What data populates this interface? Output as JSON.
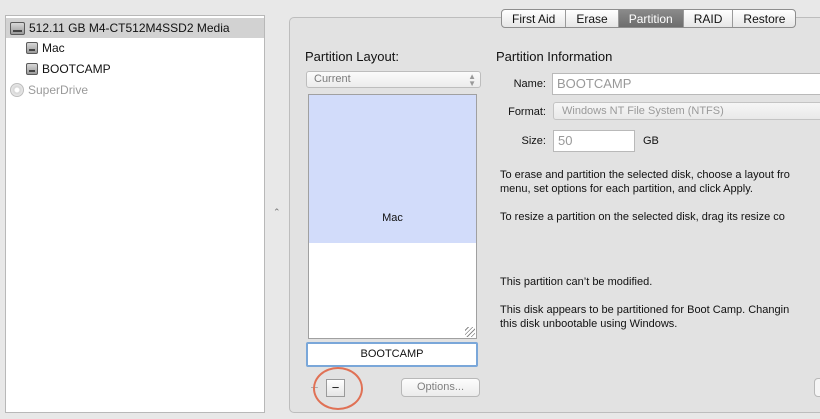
{
  "sidebar": {
    "disk": "512.11 GB M4-CT512M4SSD2 Media",
    "volumes": [
      "Mac",
      "BOOTCAMP"
    ],
    "drive": "SuperDrive"
  },
  "tabs": [
    {
      "label": "First Aid",
      "active": false
    },
    {
      "label": "Erase",
      "active": false
    },
    {
      "label": "Partition",
      "active": true
    },
    {
      "label": "RAID",
      "active": false
    },
    {
      "label": "Restore",
      "active": false
    }
  ],
  "partition_layout": {
    "title": "Partition Layout:",
    "selected": "Current",
    "partitions": [
      "Mac"
    ],
    "selected_partition_name": "BOOTCAMP",
    "plus_label": "+",
    "minus_label": "−",
    "options_label": "Options..."
  },
  "partition_info": {
    "title": "Partition Information",
    "name_label": "Name:",
    "name_value": "BOOTCAMP",
    "format_label": "Format:",
    "format_value": "Windows NT File System (NTFS)",
    "size_label": "Size:",
    "size_value": "50",
    "size_unit": "GB",
    "text1_line1": "To erase and partition the selected disk, choose a layout fro",
    "text1_line2": "menu, set options for each partition, and click Apply.",
    "text2": "To resize a partition on the selected disk, drag its resize co",
    "text3": "This partition can’t be modified.",
    "text4_line1": "This disk appears to be partitioned for Boot Camp. Changin",
    "text4_line2": "this disk unbootable using Windows."
  },
  "colors": {
    "mac_partition": "#d2dcfa",
    "highlight_circle": "#e07155",
    "active_tab": "#6d6d6d"
  }
}
